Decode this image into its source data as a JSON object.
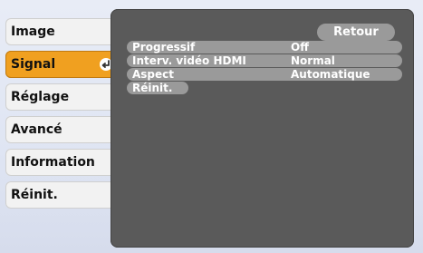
{
  "sidebar": {
    "items": [
      {
        "label": "Image"
      },
      {
        "label": "Signal"
      },
      {
        "label": "Réglage"
      },
      {
        "label": "Avancé"
      },
      {
        "label": "Information"
      },
      {
        "label": "Réinit."
      }
    ],
    "active_index": 1
  },
  "panel": {
    "back_label": "Retour",
    "rows": [
      {
        "label": "Progressif",
        "value": "Off"
      },
      {
        "label": "Interv. vidéo HDMI",
        "value": "Normal"
      },
      {
        "label": "Aspect",
        "value": "Automatique"
      },
      {
        "label": "Réinit.",
        "value": ""
      }
    ]
  },
  "colors": {
    "active_item": "#f0a020",
    "panel_bg": "#5a5a5a",
    "row_bar": "#9a9a9a"
  }
}
